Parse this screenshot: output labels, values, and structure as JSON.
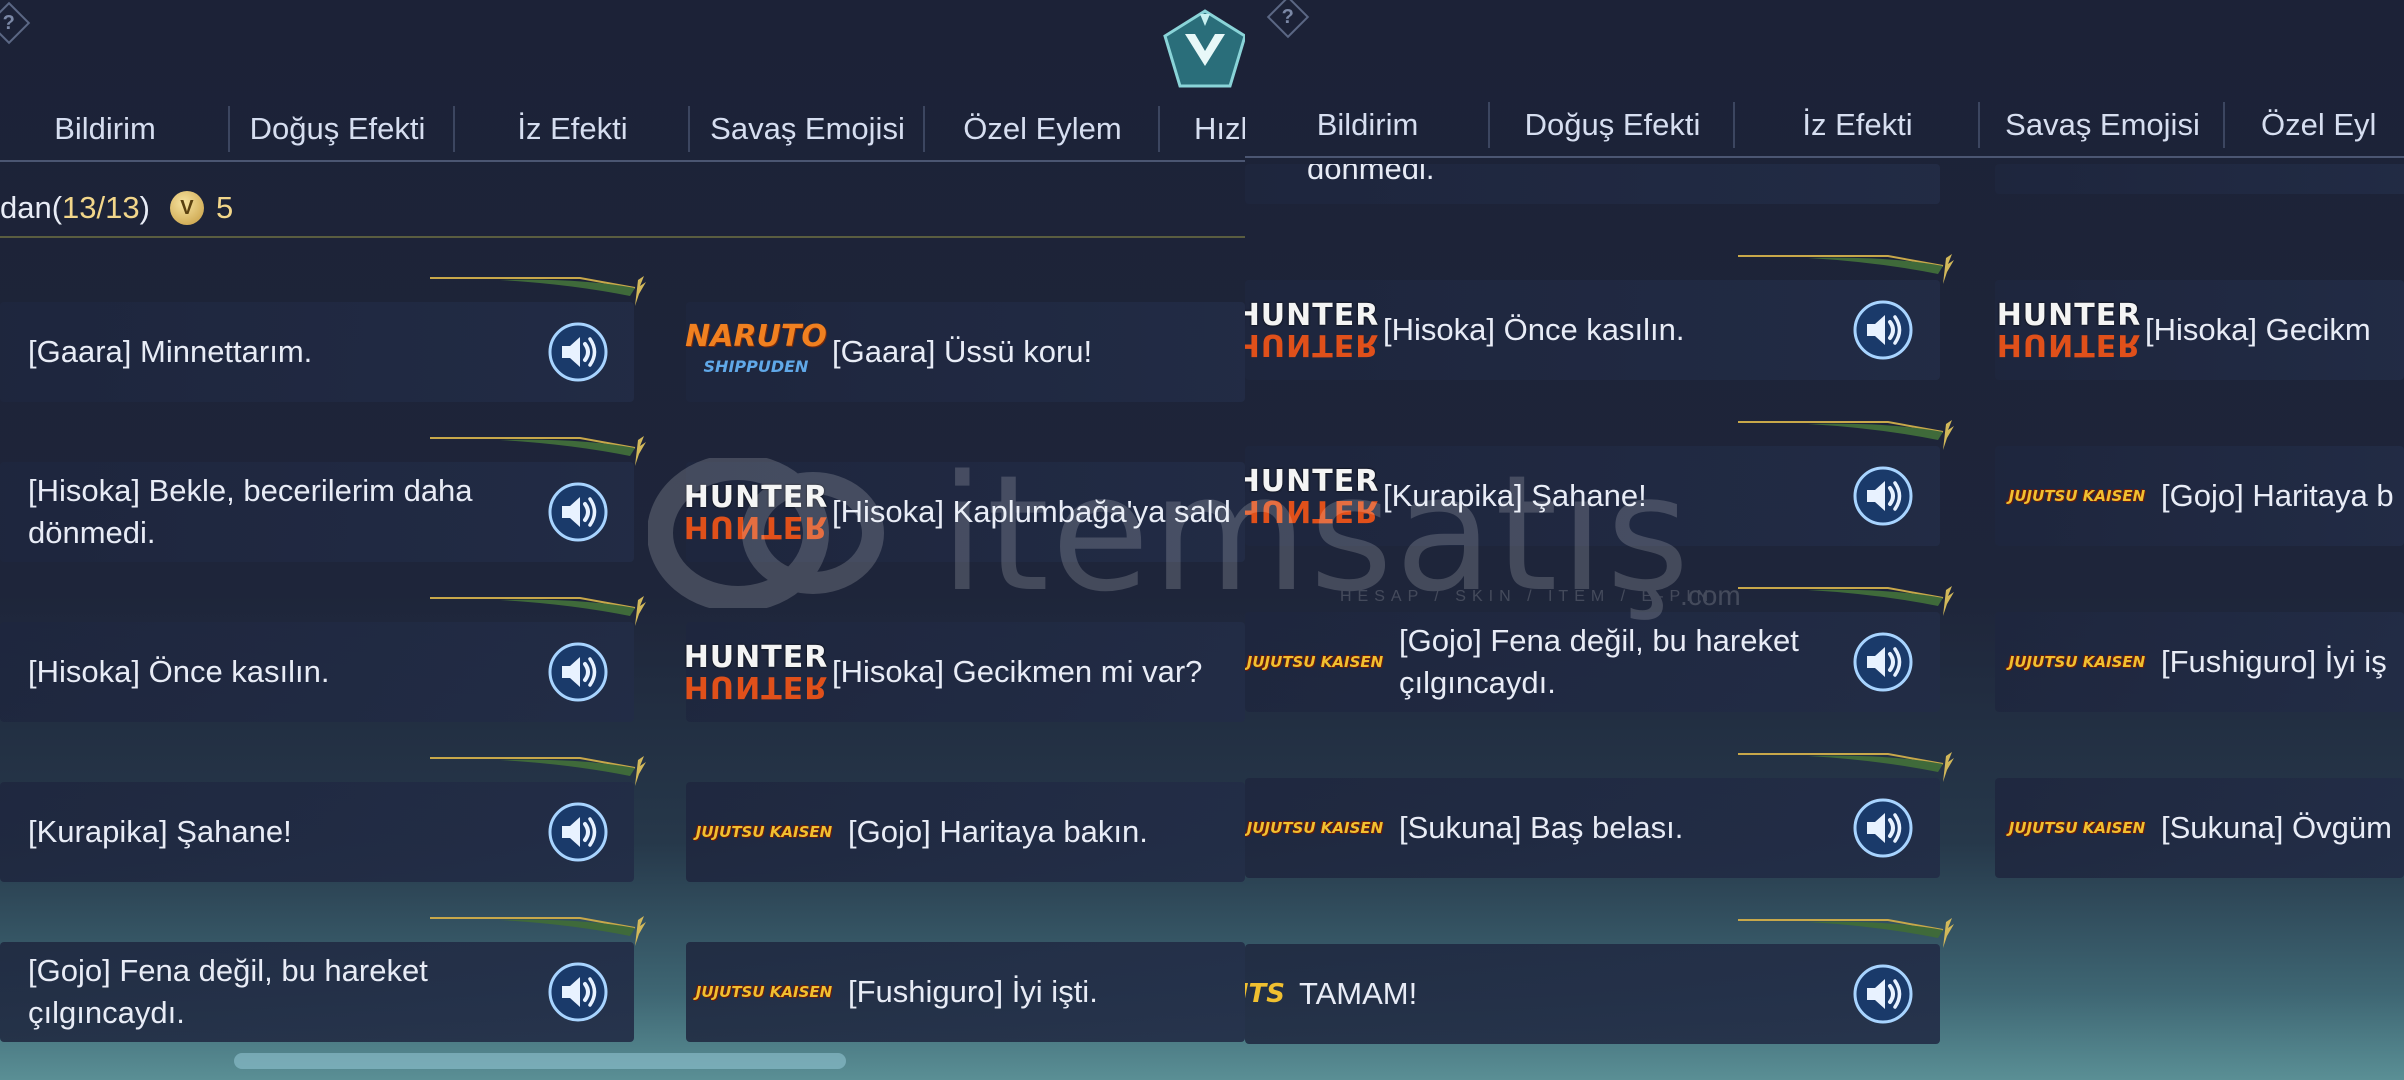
{
  "tabs_left": [
    "Bildirim",
    "Doğuş Efekti",
    "İz Efekti",
    "Savaş Emojisi",
    "Özel Eylem",
    "Hızl"
  ],
  "tabs_right": [
    "Bildirim",
    "Doğuş Efekti",
    "İz Efekti",
    "Savaş Emojisi",
    "Özel Eyl"
  ],
  "counter": {
    "label_prefix": "dan(",
    "owned": "13/13",
    "label_suffix": ")",
    "coin_value": "5"
  },
  "left_cards_col1": [
    "[Gaara] Minnettarım.",
    "[Hisoka] Bekle, becerilerim daha\ndönmedi.",
    "[Hisoka] Önce kasılın.",
    "[Kurapika] Şahane!",
    "[Gojo] Fena değil, bu hareket\nçılgıncaydı."
  ],
  "left_cards_col2": [
    "[Gaara] Üssü koru!",
    "[Hisoka] Kaplumbağa'ya sald",
    "[Hisoka] Gecikmen mi var?",
    "[Gojo] Haritaya bakın.",
    "[Fushiguro] İyi işti."
  ],
  "right_top_partial": "dönmedi.",
  "right_cards_col1": [
    "[Hisoka] Önce kasılın.",
    "[Kurapika] Şahane!",
    "[Gojo] Fena değil, bu hareket\nçılgıncaydı.",
    "[Sukuna] Baş belası.",
    "TAMAM!"
  ],
  "right_cards_col2": [
    "[Hisoka] Gecikm",
    "[Gojo] Haritaya b",
    "[Fushiguro] İyi iş",
    "[Sukuna] Övgüm"
  ],
  "logos": {
    "hunter_top": "HUNTER",
    "hunter_bottom": "HUNTER",
    "jjk": "JUJUTSU KAISEN",
    "naruto": "NARUTO",
    "naruto_sub": "SHIPPUDEN",
    "partial_hunter": "ER",
    "partial_jjk": "isen",
    "partial_mlbb": "NTS"
  },
  "watermark": {
    "word": "itemsatış",
    "com": ".com",
    "sub": "HESAP / SKIN / ITEM / E-PIN"
  },
  "colors": {
    "accent_gold": "#f2d68a",
    "speaker_blue": "#7ab4f0",
    "vine_green": "#5c8a4a"
  },
  "icons": [
    "help-icon",
    "rank-emblem-icon",
    "speaker-icon",
    "coin-icon"
  ]
}
